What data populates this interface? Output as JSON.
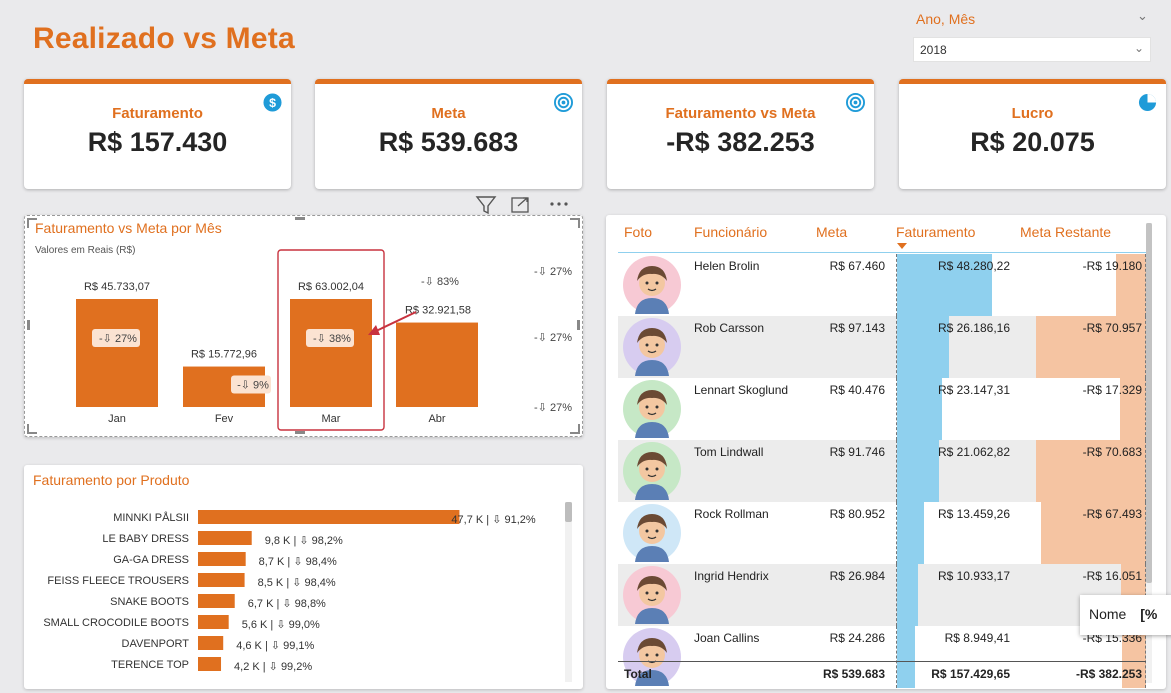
{
  "page": {
    "title": "Realizado vs Meta"
  },
  "slicer": {
    "label": "Ano, Mês",
    "value": "2018",
    "chevron": "chevron-down-icon"
  },
  "cards": [
    {
      "label": "Faturamento",
      "value": "R$ 157.430",
      "icon": "dollar-icon"
    },
    {
      "label": "Meta",
      "value": "R$ 539.683",
      "icon": "target-icon"
    },
    {
      "label": "Faturamento vs Meta",
      "value": "-R$ 382.253",
      "icon": "target-icon"
    },
    {
      "label": "Lucro",
      "value": "R$ 20.075",
      "icon": "pie-icon"
    }
  ],
  "visual_header": {
    "icons": [
      "filter-icon",
      "focus-mode-icon",
      "more-options-icon"
    ]
  },
  "chart_data": [
    {
      "type": "bar",
      "title": "Faturamento vs Meta por Mês",
      "subtitle": "Valores em Reais (R$)",
      "categories": [
        "Jan",
        "Fev",
        "Mar",
        "Abr"
      ],
      "values": [
        45733.07,
        15772.96,
        63002.04,
        32921.58
      ],
      "value_labels": [
        "R$ 45.733,07",
        "R$ 15.772,96",
        "R$ 63.002,04",
        "R$ 32.921,58"
      ],
      "badges": [
        "-⇩ 27%",
        "-⇩ 9%",
        "-⇩ 38%",
        "-⇩ 83%"
      ],
      "right_labels": [
        "-⇩ 27%",
        "-⇩ 27%",
        "-⇩ 27%"
      ],
      "highlighted": "Mar",
      "ylim": [
        0,
        80000
      ]
    },
    {
      "type": "bar",
      "orientation": "horizontal",
      "title": "Faturamento por Produto",
      "categories": [
        "MINNKI PÅLSII",
        "LE BABY DRESS",
        "GA-GA DRESS",
        "FEISS FLEECE TROUSERS",
        "SNAKE BOOTS",
        "SMALL CROCODILE BOOTS",
        "DAVENPORT",
        "TERENCE TOP"
      ],
      "values": [
        47.7,
        9.8,
        8.7,
        8.5,
        6.7,
        5.6,
        4.6,
        4.2
      ],
      "value_labels": [
        "47,7 K | ⇩ 91,2%",
        "9,8 K | ⇩ 98,2%",
        "8,7 K | ⇩ 98,4%",
        "8,5 K | ⇩ 98,4%",
        "6,7 K | ⇩ 98,8%",
        "5,6 K | ⇩ 99,0%",
        "4,6 K | ⇩ 99,1%",
        "4,2 K | ⇩ 99,2%"
      ],
      "xlim": [
        0,
        52
      ]
    }
  ],
  "table": {
    "headers": [
      "Foto",
      "Funcionário",
      "Meta",
      "Faturamento",
      "Meta Restante"
    ],
    "rows": [
      {
        "name": "Helen Brolin",
        "meta": "R$ 67.460",
        "fat": "R$ 48.280,22",
        "rest": "-R$ 19.180",
        "fat_pct": 0.84,
        "rest_pct": 0.27,
        "avatar_bg": "#f7c9d4",
        "avatar": "woman-glasses-avatar-icon"
      },
      {
        "name": "Rob Carsson",
        "meta": "R$ 97.143",
        "fat": "R$ 26.186,16",
        "rest": "-R$ 70.957",
        "fat_pct": 0.46,
        "rest_pct": 1.0,
        "avatar_bg": "#d7ccf0",
        "avatar": "man-beard-avatar-icon"
      },
      {
        "name": "Lennart Skoglund",
        "meta": "R$ 40.476",
        "fat": "R$ 23.147,31",
        "rest": "-R$ 17.329",
        "fat_pct": 0.4,
        "rest_pct": 0.24,
        "avatar_bg": "#c6e8c6",
        "avatar": "man-hat-avatar-icon"
      },
      {
        "name": "Tom Lindwall",
        "meta": "R$ 91.746",
        "fat": "R$ 21.062,82",
        "rest": "-R$ 70.683",
        "fat_pct": 0.37,
        "rest_pct": 1.0,
        "avatar_bg": "#c6e8c6",
        "avatar": "man-avatar-icon"
      },
      {
        "name": "Rock Rollman",
        "meta": "R$ 80.952",
        "fat": "R$ 13.459,26",
        "rest": "-R$ 67.493",
        "fat_pct": 0.24,
        "rest_pct": 0.95,
        "avatar_bg": "#cfe7f7",
        "avatar": "man-avatar-icon"
      },
      {
        "name": "Ingrid Hendrix",
        "meta": "R$ 26.984",
        "fat": "R$ 10.933,17",
        "rest": "-R$ 16.051",
        "fat_pct": 0.19,
        "rest_pct": 0.23,
        "avatar_bg": "#f7c9d4",
        "avatar": "woman-glasses-avatar-icon"
      },
      {
        "name": "Joan Callins",
        "meta": "R$ 24.286",
        "fat": "R$ 8.949,41",
        "rest": "-R$ 15.336",
        "fat_pct": 0.16,
        "rest_pct": 0.22,
        "avatar_bg": "#d7ccf0",
        "avatar": "woman-avatar-icon"
      }
    ],
    "total": {
      "label": "Total",
      "meta": "R$ 539.683",
      "fat": "R$ 157.429,65",
      "rest": "-R$ 382.253"
    }
  },
  "tooltip": {
    "text": "Nome",
    "extra": "[%"
  },
  "colors": {
    "accent": "#e0701f",
    "fat_bar": "#8fd0ee",
    "rest_bar": "#f5c4a2",
    "highlight": "#c8323e"
  }
}
